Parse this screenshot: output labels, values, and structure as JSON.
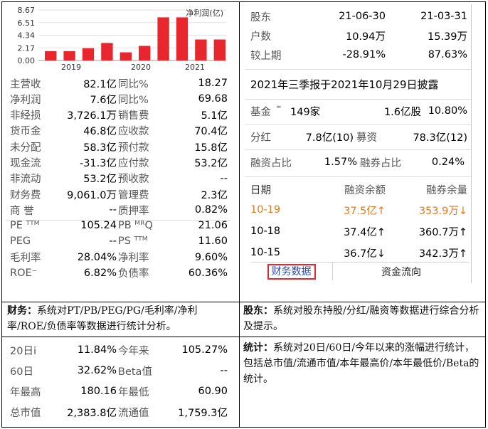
{
  "chart_data": {
    "type": "bar",
    "title": "",
    "legend": "净利润(亿)",
    "y_ticks": [
      "8.67",
      "6.51",
      "4.34",
      "2.17",
      "0.00"
    ],
    "ylim": [
      0,
      8.67
    ],
    "year_labels": [
      "2019",
      "2020",
      "2021"
    ],
    "values": [
      1.6,
      1.6,
      2.1,
      3.0,
      1.4,
      2.5,
      7.4,
      7.4,
      3.6,
      3.6
    ],
    "bar_color": "#e8262d"
  },
  "finance": {
    "rows": [
      {
        "l1": "主营收",
        "v1": "82.1亿",
        "l2": "同比%",
        "v2": "18.27"
      },
      {
        "l1": "净利润",
        "v1": "7.6亿",
        "l2": "同比%",
        "v2": "69.68"
      },
      {
        "l1": "非经损",
        "v1": "3,726.1万",
        "l2": "销售费",
        "v2": "5.1亿"
      },
      {
        "l1": "货币金",
        "v1": "46.8亿",
        "l2": "应收款",
        "v2": "70.4亿"
      },
      {
        "l1": "未分配",
        "v1": "58.3亿",
        "l2": "预付款",
        "v2": "15.8亿"
      },
      {
        "l1": "现金流",
        "v1": "-31.3亿",
        "l2": "应付款",
        "v2": "53.2亿"
      },
      {
        "l1": "非流动",
        "v1": "53.2亿",
        "l2": "预收款",
        "v2": "--"
      },
      {
        "l1": "财务费",
        "v1": "9,061.0万",
        "l2": "管理费",
        "v2": "2.3亿"
      },
      {
        "l1": "商 誉",
        "v1": "--",
        "l2": "质押率",
        "v2": "0.82%"
      }
    ],
    "ratios": [
      {
        "l1": "PE ᵀᵀᴹ",
        "v1": "105.24",
        "l2": "PB ᴹᴿQ",
        "v2": "21.06"
      },
      {
        "l1": "PEG",
        "v1": "--",
        "l2": "PS ᵀᵀᴹ",
        "v2": "11.60"
      },
      {
        "l1": "毛利率",
        "v1": "28.04%",
        "l2": "净利率",
        "v2": "9.60%"
      },
      {
        "l1": "ROE⁻",
        "v1": "6.82%",
        "l2": "负债率",
        "v2": "60.36%"
      }
    ]
  },
  "holders": {
    "header": {
      "label": "股东",
      "d1": "21-06-30",
      "d2": "21-03-31"
    },
    "rows": [
      {
        "label": "户数",
        "v1": "10.94万",
        "v2": "15.39万"
      },
      {
        "label": "较上期",
        "v1": "-28.91%",
        "v2": "87.63%"
      }
    ],
    "disclosure": "2021年三季报于2021年10月29日披露",
    "fund": {
      "label": "基金",
      "sup": "=",
      "count": "149家",
      "shares": "1.6亿股",
      "pct": "10.80%"
    },
    "dividend": {
      "label": "分红",
      "v1": "7.8亿(10)",
      "label2": "募资",
      "v2": "78.3亿(12)"
    },
    "margin_ratio": {
      "label": "融资占比",
      "v1": "1.57%",
      "label2": "融券占比",
      "v2": "0.24%"
    },
    "margin_table": {
      "headers": [
        "日期",
        "融资余额",
        "融券余量"
      ],
      "rows": [
        {
          "date": "10-19",
          "fin": "37.5亿↑",
          "sec": "353.9万↓",
          "highlight": true
        },
        {
          "date": "10-18",
          "fin": "37.4亿↑",
          "sec": "360.7万↑",
          "highlight": false
        },
        {
          "date": "10-15",
          "fin": "36.7亿↓",
          "sec": "342.3万↑",
          "highlight": false
        }
      ]
    },
    "tabs": {
      "finance": "财务数据",
      "flow": "资金流向"
    }
  },
  "captions": {
    "finance_title": "财务：",
    "finance_text": "系统对PT/PB/PEG/PG/毛利率/净利率/ROE/负债率等数据进行统计分析。",
    "holder_title": "股东：",
    "holder_text": "系统对股东持股/分红/融资等数据进行综合分析及提示。",
    "stats_title": "统计：",
    "stats_text": "系统对20日/60日/今年以来的涨幅进行统计，包括总市值/流通市值/本年最高价/本年最低价/Beta的统计。"
  },
  "stats": {
    "rows": [
      {
        "l1": "20日i",
        "v1": "11.84%",
        "l2": "今年来",
        "v2": "105.27%"
      },
      {
        "l1": "60日",
        "v1": "32.62%",
        "l2": "Beta值",
        "v2": "--"
      },
      {
        "l1": "年最高",
        "v1": "180.16",
        "l2": "年最低",
        "v2": "60.90"
      },
      {
        "l1": "总市值",
        "v1": "2,383.8亿",
        "l2": "流通值",
        "v2": "1,759.3亿"
      }
    ]
  }
}
